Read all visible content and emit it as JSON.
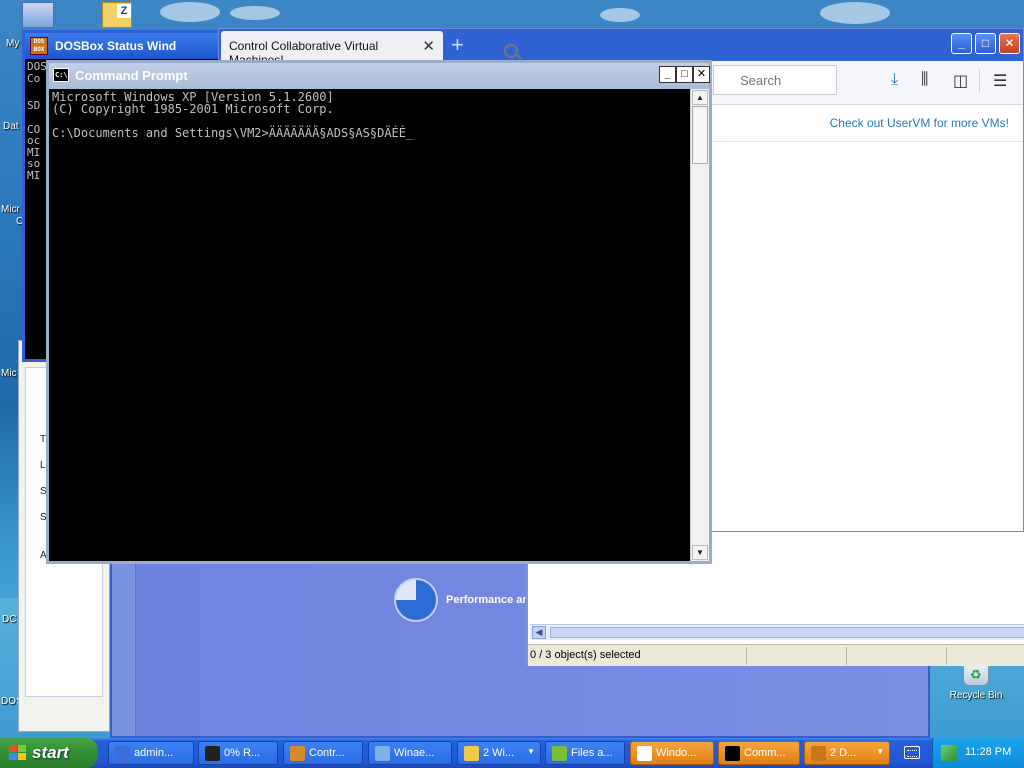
{
  "desktop": {
    "icon_labels": [
      "My",
      "Dat",
      "Micr",
      "C",
      "Mic",
      "DC",
      "DOS"
    ],
    "recycle_bin_label": "Recycle Bin"
  },
  "dosbox": {
    "title": "DOSBox Status Wind",
    "logo_text": "DOS BOX",
    "lines": [
      "DOS",
      "Co",
      "SD",
      "CO",
      "oc",
      "MI",
      "so",
      "MI"
    ]
  },
  "browser": {
    "tab_title": "Control Collaborative Virtual Machines!",
    "tab_close": "✕",
    "new_tab": "+",
    "search_placeholder": "Search",
    "banner_link": "Check out UserVM for more VMs!"
  },
  "command_prompt": {
    "title": "Command Prompt",
    "lines": [
      "Microsoft Windows XP [Version 5.1.2600]",
      "(C) Copyright 1985-2001 Microsoft Corp.",
      "",
      "C:\\Documents and Settings\\VM2>ÄÄÄÄÄÄÄ§ADS§AS§DÄÉÉ_"
    ]
  },
  "control_panel": {
    "category_label": "Performance and"
  },
  "explorer": {
    "status_text": "0 / 3 object(s) selected"
  },
  "side_panel": {
    "letters": [
      "T",
      "L",
      "S",
      "S",
      "A"
    ]
  },
  "taskbar": {
    "start_label": "start",
    "items": [
      {
        "label": "admin...",
        "icon_color": "#3b6fd8"
      },
      {
        "label": "0% R...",
        "icon_color": "#222222"
      },
      {
        "label": "Contr...",
        "icon_color": "#d68b2b"
      },
      {
        "label": "Winae...",
        "icon_color": "#7fb0e8"
      },
      {
        "label": "2 Wi...",
        "icon_color": "#f2c94c"
      },
      {
        "label": "Files a...",
        "icon_color": "#7bbd3b"
      },
      {
        "label": "Windo...",
        "icon_color": "#ffffff"
      },
      {
        "label": "Comm...",
        "icon_color": "#000000"
      },
      {
        "label": "2 D...",
        "icon_color": "#c9761b"
      }
    ],
    "clock": "11:28 PM"
  }
}
